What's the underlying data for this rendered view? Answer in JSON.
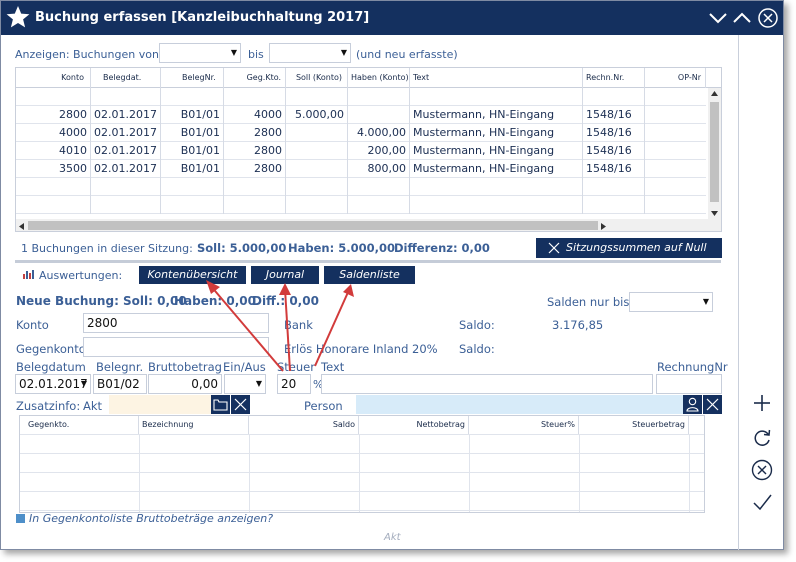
{
  "window": {
    "title": "Buchung erfassen [Kanzleibuchhaltung 2017]"
  },
  "filter": {
    "anzeigen_label": "Anzeigen: Buchungen von",
    "von_value": "",
    "bis_label": "bis",
    "bis_value": "",
    "neu_label": "(und neu erfasste)"
  },
  "table": {
    "columns": [
      "Konto",
      "Belegdat.",
      "BelegNr.",
      "Geg.Kto.",
      "Soll (Konto)",
      "Haben (Konto)",
      "Text",
      "Rechn.Nr.",
      "OP-Nr"
    ],
    "rows": [
      [
        "2800",
        "02.01.2017",
        "B01/01",
        "4000",
        "5.000,00",
        "",
        "Mustermann, HN-Eingang",
        "1548/16",
        ""
      ],
      [
        "4000",
        "02.01.2017",
        "B01/01",
        "2800",
        "",
        "4.000,00",
        "Mustermann, HN-Eingang",
        "1548/16",
        ""
      ],
      [
        "4010",
        "02.01.2017",
        "B01/01",
        "2800",
        "",
        "200,00",
        "Mustermann, HN-Eingang",
        "1548/16",
        ""
      ],
      [
        "3500",
        "02.01.2017",
        "B01/01",
        "2800",
        "",
        "800,00",
        "Mustermann, HN-Eingang",
        "1548/16",
        ""
      ]
    ]
  },
  "session": {
    "summary": "1 Buchungen in dieser Sitzung:",
    "soll": "Soll: 5.000,00",
    "haben": "Haben: 5.000,00",
    "differenz": "Differenz: 0,00",
    "reset_button": "Sitzungssummen auf Null"
  },
  "auswertungen": {
    "label": "Auswertungen:",
    "buttons": [
      "Kontenübersicht",
      "Journal",
      "Saldenliste"
    ]
  },
  "neue_buchung": {
    "header": "Neue Buchung: Soll: 0,00",
    "haben": "Haben: 0,00",
    "diff": "Diff.: 0,00",
    "salden_label": "Salden nur bis",
    "salden_value": "",
    "konto_label": "Konto",
    "konto_value": "2800",
    "konto_name": "Bank",
    "saldo_label": "Saldo:",
    "saldo_value": "3.176,85",
    "gegenkonto_label": "Gegenkonto",
    "gegenkonto_value": "",
    "gegenkonto_name": "Erlös Honorare Inland 20%",
    "saldo2_label": "Saldo:",
    "saldo2_value": ""
  },
  "fields": {
    "belegdatum_label": "Belegdatum",
    "belegdatum_value": "02.01.2017",
    "belegnr_label": "Belegnr.",
    "belegnr_value": "B01/02",
    "brutto_label": "Bruttobetrag",
    "brutto_value": "0,00",
    "einaus_label": "Ein/Aus",
    "einaus_value": "",
    "steuer_label": "Steuer",
    "steuer_value": "20",
    "percent": "%",
    "text_label": "Text",
    "text_value": "",
    "rechnungnr_label": "RechnungNr",
    "rechnungnr_value": ""
  },
  "zusatz": {
    "label": "Zusatzinfo:",
    "akt_label": "Akt",
    "akt_value": "",
    "person_label": "Person",
    "person_value": ""
  },
  "gegenkonto_table": {
    "columns": [
      "Gegenkto.",
      "Bezeichnung",
      "Saldo",
      "Nettobetrag",
      "Steuer%",
      "Steuerbetrag"
    ]
  },
  "footer": {
    "checkbox_label": "In Gegenkontoliste Bruttobeträge anzeigen?",
    "status": "Akt"
  },
  "colors": {
    "navy": "#14305f",
    "label_blue": "#3b5f96",
    "arrow_red": "#d23b3b",
    "akt_bg": "#fdf4e3",
    "person_bg": "#d7ebf9"
  },
  "icons": {
    "title": "star-icon",
    "window_controls": [
      "minimize-icon",
      "maximize-icon",
      "close-icon"
    ],
    "sidebar": [
      "plus-icon",
      "refresh-icon",
      "cancel-icon",
      "check-icon"
    ]
  }
}
